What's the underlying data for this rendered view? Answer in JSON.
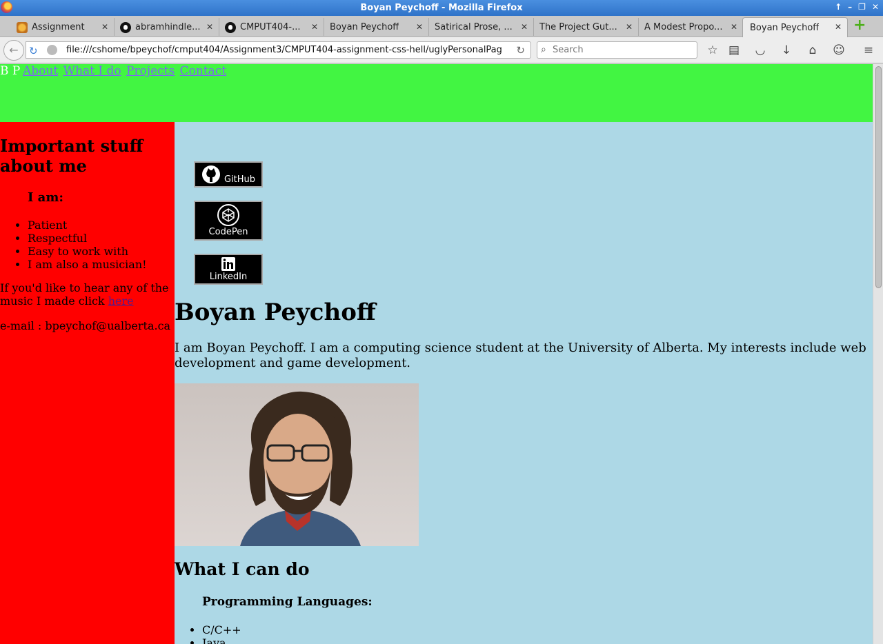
{
  "window": {
    "title": "Boyan Peychoff - Mozilla Firefox"
  },
  "tabs": [
    {
      "label": "Assignment",
      "icon": "assignment-icon"
    },
    {
      "label": "abramhindle...",
      "icon": "github-icon"
    },
    {
      "label": "CMPUT404-...",
      "icon": "github-icon"
    },
    {
      "label": "Boyan Peychoff",
      "icon": ""
    },
    {
      "label": "Satirical Prose, ...",
      "icon": ""
    },
    {
      "label": "The Project Gut...",
      "icon": ""
    },
    {
      "label": "A Modest Propo...",
      "icon": ""
    },
    {
      "label": "Boyan Peychoff",
      "icon": "",
      "active": true
    }
  ],
  "navbar": {
    "url": "file:///cshome/bpeychof/cmput404/Assignment3/CMPUT404-assignment-css-hell/uglyPersonalPag",
    "search_placeholder": "Search"
  },
  "page": {
    "header": {
      "brand": "B P",
      "links": [
        "About",
        "What I do",
        "Projects",
        "Contact"
      ],
      "background": "#42f542"
    },
    "sidebar": {
      "title": "Important stuff about me",
      "subtitle": "I am:",
      "traits": [
        "Patient",
        "Respectful",
        "Easy to work with",
        "I am also a musician!"
      ],
      "music_text": "If you'd like to hear any of the music I made click",
      "music_link": "here",
      "email": "e-mail : bpeychof@ualberta.ca",
      "background": "#ff0000"
    },
    "social": [
      {
        "label": "GitHub",
        "icon": "github-icon"
      },
      {
        "label": "CodePen",
        "icon": "codepen-icon"
      },
      {
        "label": "LinkedIn",
        "icon": "linkedin-icon"
      }
    ],
    "main": {
      "title": "Boyan Peychoff",
      "intro": "I am Boyan Peychoff. I am a computing science student at the University of Alberta. My interests include web development and game development.",
      "photo": "portrait-photo",
      "skills_title": "What I can do",
      "languages_title": "Programming Languages:",
      "languages": [
        "C/C++",
        "Java"
      ],
      "background": "#add8e6"
    }
  }
}
